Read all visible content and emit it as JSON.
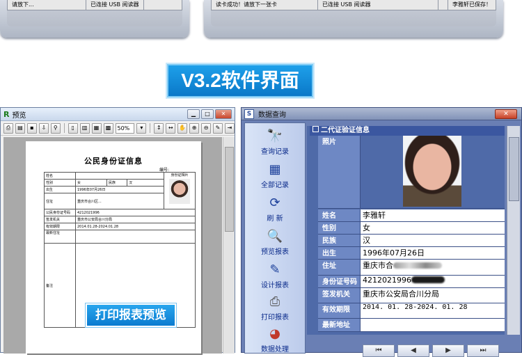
{
  "top_left_window": {
    "status_text": "请放下..."
  },
  "top_right_window": {
    "status_read_ok": "读卡成功！请放下一张卡",
    "status_connected": "已连接 USB 阅读器",
    "status_saved": "李雅轩已保存！"
  },
  "top_left_connected": "已连接 USB 阅读器",
  "banner": {
    "text": "V3.2软件界面"
  },
  "preview_window": {
    "title": "预览",
    "zoom": "50%",
    "report_title": "公民身份证信息",
    "number_label": "编号:",
    "photo_header": "身份证相片",
    "rows": [
      {
        "label": "姓名",
        "value": ""
      },
      {
        "label": "性别",
        "value": "女",
        "label2": "民族",
        "value2": "汉"
      },
      {
        "label": "出生",
        "value": "1996年07月26日"
      },
      {
        "label": "住址",
        "value": "重庆市合川区..."
      },
      {
        "label": "公民身份证号码",
        "value": "4212021996"
      },
      {
        "label": "签发机关",
        "value": "重庆市公安局合川分局"
      },
      {
        "label": "有效期限",
        "value": "2014.01.28-2024.01.28"
      },
      {
        "label": "最新住址",
        "value": ""
      },
      {
        "label": "备注",
        "value": ""
      }
    ],
    "overlay_label": "打印报表预览"
  },
  "query_window": {
    "title": "数据查询",
    "close": "✕",
    "nav": [
      {
        "label": "查询记录",
        "icon": "binoculars-icon",
        "glyph": "🔭"
      },
      {
        "label": "全部记录",
        "icon": "grid-icon",
        "glyph": "▦"
      },
      {
        "label": "刷 新",
        "icon": "refresh-icon",
        "glyph": "⟳"
      },
      {
        "label": "预览报表",
        "icon": "magnifier-icon",
        "glyph": "🔍"
      },
      {
        "label": "设计报表",
        "icon": "design-icon",
        "glyph": "✎"
      },
      {
        "label": "打印报表",
        "icon": "printer-icon",
        "glyph": "🖶"
      },
      {
        "label": "数据处理",
        "icon": "pie-chart-icon",
        "glyph": "◕"
      }
    ],
    "group_title": "二代证验证信息",
    "fields": {
      "photo_label": "照片",
      "name_label": "姓名",
      "name": "李雅轩",
      "gender_label": "性别",
      "gender": "女",
      "ethnic_label": "民族",
      "ethnic": "汉",
      "birth_label": "出生",
      "birth": "1996年07月26日",
      "address_label": "住址",
      "address": "重庆市合",
      "id_label": "身份证号码",
      "id": "4212021996",
      "issuer_label": "签发机关",
      "issuer": "重庆市公安局合川分局",
      "validity_label": "有效期限",
      "validity": "2014. 01. 28-2024. 01. 28",
      "latest_address_label": "最新地址",
      "latest_address": ""
    },
    "nav_buttons": [
      "⏮",
      "◀",
      "▶",
      "⏭"
    ]
  }
}
